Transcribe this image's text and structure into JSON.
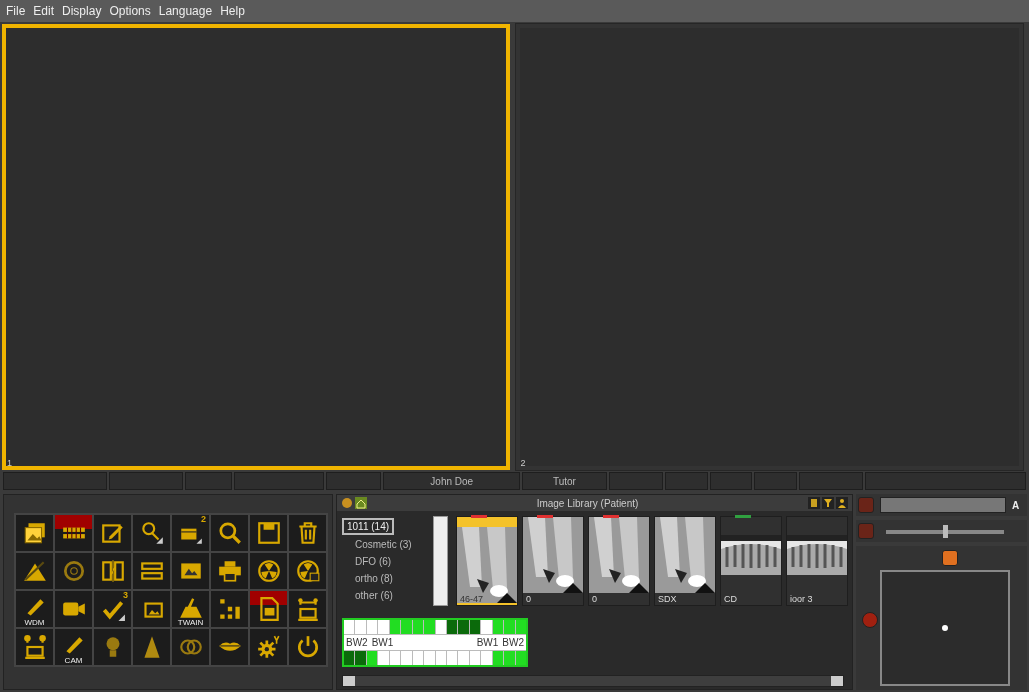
{
  "menu": [
    {
      "label": "File"
    },
    {
      "label": "Edit"
    },
    {
      "label": "Display"
    },
    {
      "label": "Options"
    },
    {
      "label": "Language"
    },
    {
      "label": "Help"
    }
  ],
  "viewports": [
    {
      "label": "1",
      "selected": true
    },
    {
      "label": "2",
      "selected": false
    }
  ],
  "status_bar": {
    "patient": "John Doe",
    "user": "Tutor"
  },
  "toolbar": [
    {
      "highlighted": false
    },
    {
      "highlighted": true
    },
    {
      "highlighted": false
    },
    {
      "highlighted": false
    },
    {
      "highlighted": false,
      "label": "2"
    },
    {
      "highlighted": false
    },
    {
      "highlighted": false
    },
    {
      "highlighted": false
    },
    {
      "highlighted": false
    },
    {
      "highlighted": false
    },
    {
      "highlighted": false
    },
    {
      "highlighted": false
    },
    {
      "highlighted": false
    },
    {
      "highlighted": false
    },
    {
      "highlighted": false
    },
    {
      "highlighted": false
    },
    {
      "highlighted": false,
      "label": "WDM"
    },
    {
      "highlighted": false
    },
    {
      "highlighted": false,
      "label": "3"
    },
    {
      "highlighted": false
    },
    {
      "highlighted": false,
      "label": "TWAIN"
    },
    {
      "highlighted": false
    },
    {
      "highlighted": true
    },
    {
      "highlighted": false
    },
    {
      "highlighted": false
    },
    {
      "highlighted": false,
      "label": "CAM"
    },
    {
      "highlighted": false
    },
    {
      "highlighted": false
    },
    {
      "highlighted": false
    },
    {
      "highlighted": false
    },
    {
      "highlighted": false
    },
    {
      "highlighted": false
    }
  ],
  "library": {
    "title": "Image Library (Patient)",
    "folders": [
      {
        "label": "1011 (14)",
        "selected": true
      },
      {
        "label": "Cosmetic (3)",
        "selected": false
      },
      {
        "label": "DFO (6)",
        "selected": false
      },
      {
        "label": "ortho (8)",
        "selected": false
      },
      {
        "label": "other (6)",
        "selected": false
      }
    ],
    "thumbnails": [
      {
        "label": "46-47",
        "selected": true,
        "kind": "periapical",
        "color": "#e03030"
      },
      {
        "label": "0",
        "selected": false,
        "kind": "periapical",
        "color": "#e03030"
      },
      {
        "label": "0",
        "selected": false,
        "kind": "periapical",
        "color": "#e03030"
      },
      {
        "label": "SDX",
        "selected": false,
        "kind": "periapical"
      },
      {
        "label": "CD",
        "selected": false,
        "kind": "panoramic",
        "color": "#30a040"
      },
      {
        "label": "ioor 3",
        "selected": false,
        "kind": "panoramic"
      }
    ],
    "tooth_chart": {
      "upper": [
        {
          "color": "#ffffff"
        },
        {
          "color": "#ffffff"
        },
        {
          "color": "#ffffff"
        },
        {
          "color": "#ffffff"
        },
        {
          "color": "#22dd22"
        },
        {
          "color": "#22dd22"
        },
        {
          "color": "#22dd22"
        },
        {
          "color": "#22dd22"
        },
        {
          "color": "#ffffff"
        },
        {
          "color": "#0b6a0b"
        },
        {
          "color": "#0b6a0b"
        },
        {
          "color": "#0b6a0b"
        },
        {
          "color": "#ffffff"
        },
        {
          "color": "#22dd22"
        },
        {
          "color": "#22dd22"
        },
        {
          "color": "#22dd22"
        }
      ],
      "labels": [
        "BW2",
        "BW1",
        "BW1",
        "BW2"
      ],
      "lower": [
        {
          "color": "#0b6a0b"
        },
        {
          "color": "#0b6a0b"
        },
        {
          "color": "#22dd22"
        },
        {
          "color": "#ffffff"
        },
        {
          "color": "#ffffff"
        },
        {
          "color": "#ffffff"
        },
        {
          "color": "#ffffff"
        },
        {
          "color": "#ffffff"
        },
        {
          "color": "#ffffff"
        },
        {
          "color": "#ffffff"
        },
        {
          "color": "#ffffff"
        },
        {
          "color": "#ffffff"
        },
        {
          "color": "#ffffff"
        },
        {
          "color": "#22dd22"
        },
        {
          "color": "#22dd22"
        },
        {
          "color": "#22dd22"
        }
      ]
    }
  },
  "controls": {
    "field_label": "A",
    "slider": {
      "level": 0.5
    }
  }
}
